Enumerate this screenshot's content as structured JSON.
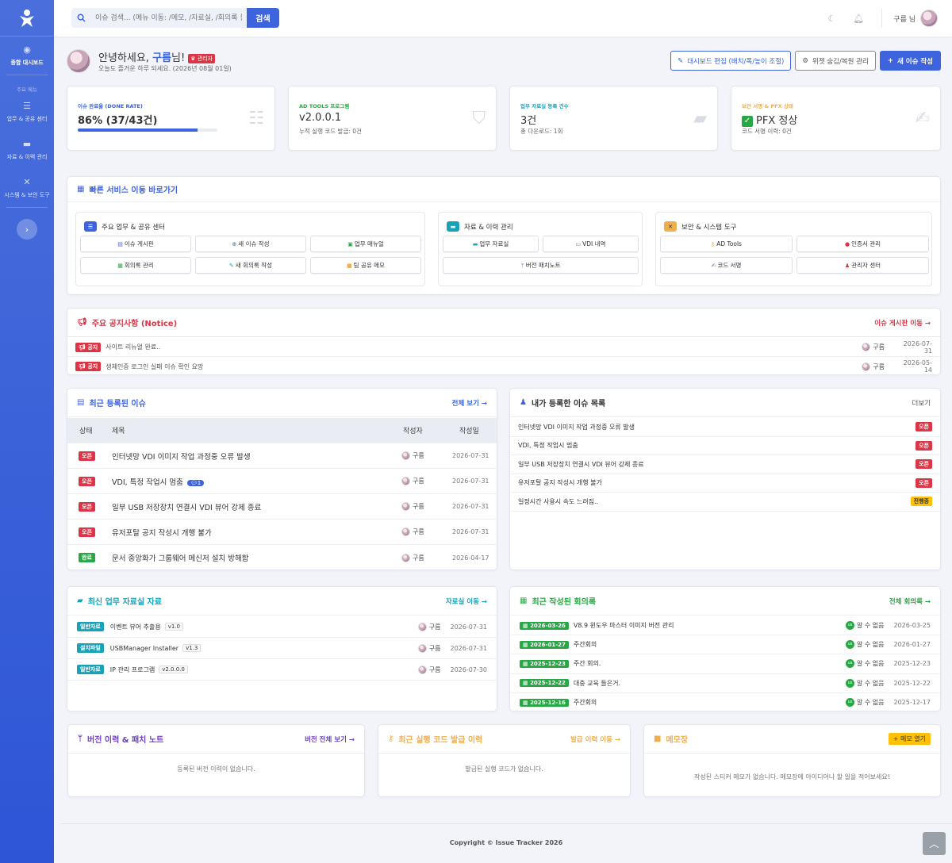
{
  "sidebar": {
    "items": [
      {
        "label": "종합 대시보드",
        "icon": "dashboard-icon"
      },
      {
        "label": "업무 & 공유 센터",
        "icon": "tasks-icon"
      },
      {
        "label": "자료 & 이력 관리",
        "icon": "folder-icon"
      },
      {
        "label": "시스템 & 보안 도구",
        "icon": "tools-icon"
      }
    ],
    "section_label": "주요 메뉴"
  },
  "search": {
    "placeholder": "이슈 검색... (메뉴 이동: /메모, /자료실, /회의록 등)",
    "button": "검색"
  },
  "user": {
    "name": "구름 님"
  },
  "greeting": {
    "prefix": "안녕하세요, ",
    "name": "구름",
    "suffix": "님!",
    "badge": "관리자",
    "sub": "오늘도 즐거운 하루 되세요. (2026년 08월 01일)"
  },
  "actions": {
    "edit": "대시보드 편집 (배치/폭/높이 조절)",
    "widget": "위젯 숨김/복원 관리",
    "new_issue": "새 이슈 작성"
  },
  "stats": [
    {
      "label": "이슈 완료율 (DONE RATE)",
      "value": "86% (37/43건)",
      "progress": 86,
      "color": "#3d63dd"
    },
    {
      "label": "AD TOOLS 프로그램",
      "value": "v2.0.0.1",
      "sub": "누적 실행 코드 발급: 0건",
      "color": "#28a745"
    },
    {
      "label": "업무 자료실 등록 건수",
      "value": "3건",
      "sub": "총 다운로드: 1회",
      "color": "#17a2b8"
    },
    {
      "label": "보안 서명 & PFX 상태",
      "value": "PFX 정상",
      "sub": "코드 서명 이력: 0건",
      "color": "#f0ad4e"
    }
  ],
  "quick": {
    "title": "빠른 서비스 이동 바로가기",
    "groups": [
      {
        "title": "주요 업무 & 공유 센터",
        "items": [
          "이슈 게시판",
          "새 이슈 작성",
          "업무 매뉴얼",
          "회의록 관리",
          "새 회의록 작성",
          "팀 공유 메모"
        ]
      },
      {
        "title": "자료 & 이력 관리",
        "items": [
          "업무 자료실",
          "VDI 내역",
          "버전 패치노트"
        ]
      },
      {
        "title": "보안 & 시스템 도구",
        "items": [
          "AD Tools",
          "인증서 관리",
          "코드 서명",
          "관리자 센터"
        ]
      }
    ]
  },
  "notice": {
    "title": "주요 공지사항 (Notice)",
    "link": "이슈 게시판 이동 →",
    "tag": "공지",
    "rows": [
      {
        "title": "사이트 리뉴얼 완료..",
        "author": "구름",
        "date": "2026-07-31"
      },
      {
        "title": "생체인증 로그인 실패 이슈 확인 요망",
        "author": "구름",
        "date": "2026-05-14"
      }
    ]
  },
  "recent": {
    "title": "최근 등록된 이슈",
    "link": "전체 보기 →",
    "headers": [
      "상태",
      "제목",
      "작성자",
      "작성일"
    ],
    "rows": [
      {
        "status": "오픈",
        "title": "인터넷망 VDI 이미지 작업 과정중 오류 발생",
        "author": "구름",
        "date": "2026-07-31",
        "comments": ""
      },
      {
        "status": "오픈",
        "title": "VDI, 특정 작업시 멈춤",
        "author": "구름",
        "date": "2026-07-31",
        "comments": "1"
      },
      {
        "status": "오픈",
        "title": "일부 USB 저장장치 연결시 VDI 뷰어 강제 종료",
        "author": "구름",
        "date": "2026-07-31",
        "comments": ""
      },
      {
        "status": "오픈",
        "title": "유저포탈 공지 작성시 개행 불가",
        "author": "구름",
        "date": "2026-07-31",
        "comments": ""
      },
      {
        "status": "완료",
        "title": "문서 중앙화가 그룹웨어 메신저 설치 방해함",
        "author": "구름",
        "date": "2026-04-17",
        "comments": ""
      }
    ]
  },
  "mine": {
    "title": "내가 등록한 이슈 목록",
    "link": "더보기",
    "rows": [
      {
        "title": "인터넷망 VDI 이미지 작업 과정중 오류 발생",
        "status": "오픈"
      },
      {
        "title": "VDI, 특정 작업시 멈춤",
        "status": "오픈"
      },
      {
        "title": "일부 USB 저장장치 연결시 VDI 뷰어 강제 종료",
        "status": "오픈"
      },
      {
        "title": "유저포탈 공지 작성시 개행 불가",
        "status": "오픈"
      },
      {
        "title": "일정시간 사용시 속도 느려짐..",
        "status": "진행중"
      }
    ]
  },
  "files": {
    "title": "최신 업무 자료실 자료",
    "link": "자료실 이동 →",
    "rows": [
      {
        "cat": "일반자료",
        "title": "이벤트 뷰어 추출용",
        "ver": "v1.0",
        "author": "구름",
        "date": "2026-07-31"
      },
      {
        "cat": "설치파일",
        "title": "USBManager Installer",
        "ver": "v1.3",
        "author": "구름",
        "date": "2026-07-31"
      },
      {
        "cat": "일반자료",
        "title": "IP 관리 프로그램",
        "ver": "v2.0.0.0",
        "author": "구름",
        "date": "2026-07-30"
      }
    ]
  },
  "meetings": {
    "title": "최근 작성된 회의록",
    "link": "전체 회의록 →",
    "rows": [
      {
        "date": "2026-03-26",
        "title": "V8.9 윈도우 마스터 이미지 버전 관리",
        "author": "알 수 없음",
        "created": "2026-03-25"
      },
      {
        "date": "2026-01-27",
        "title": "주간회의",
        "author": "알 수 없음",
        "created": "2026-01-27"
      },
      {
        "date": "2025-12-23",
        "title": "주간 회의.",
        "author": "알 수 없음",
        "created": "2025-12-23"
      },
      {
        "date": "2025-12-22",
        "title": "대충 교육 들은거.",
        "author": "알 수 없음",
        "created": "2025-12-22"
      },
      {
        "date": "2025-12-16",
        "title": "주간회의",
        "author": "알 수 없음",
        "created": "2025-12-17"
      }
    ]
  },
  "versions": {
    "title": "버전 이력 & 패치 노트",
    "link": "버전 전체 보기 →",
    "empty": "등록된 버전 이력이 없습니다."
  },
  "codes": {
    "title": "최근 실행 코드 발급 이력",
    "link": "발급 이력 이동 →",
    "empty": "발급된 실행 코드가 없습니다."
  },
  "memo": {
    "title": "메모장",
    "button": "메모 열기",
    "empty": "작성된 스티커 메모가 없습니다. 메모장에 아이디어나 할 일을 적어보세요!"
  },
  "footer": {
    "text": "Copyright © Issue Tracker 2026"
  }
}
